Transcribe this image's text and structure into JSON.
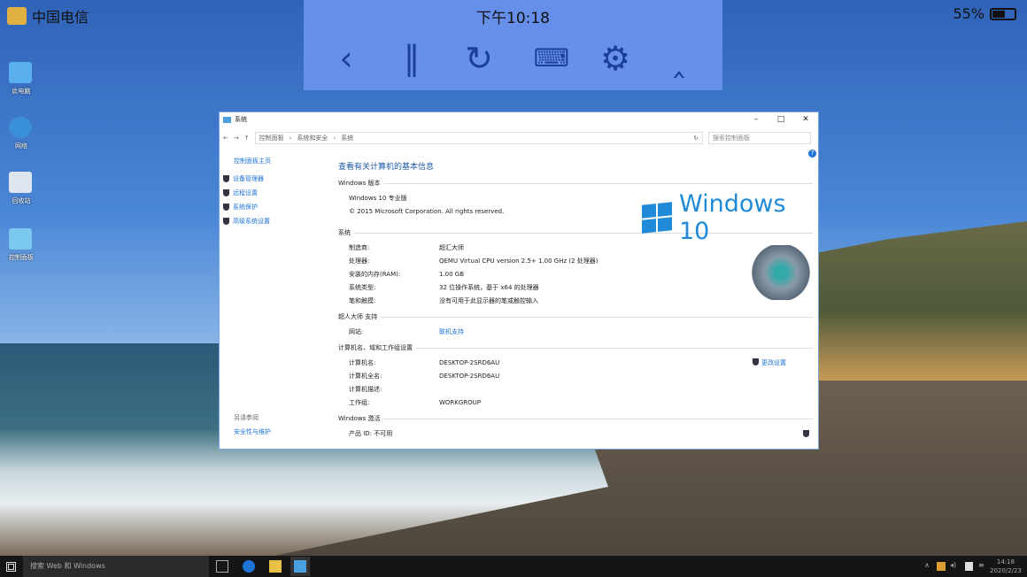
{
  "statusbar": {
    "carrier": "中国电信",
    "time": "下午10:18",
    "battery": "55%"
  },
  "remote_toolbar": {
    "icons": [
      "back-icon",
      "pause-icon",
      "rotate-icon",
      "keyboard-icon",
      "settings-icon",
      "collapse-icon"
    ]
  },
  "desktop": {
    "icons": [
      "此电脑",
      "网络",
      "回收站",
      "控制面板"
    ]
  },
  "window": {
    "title": "系统",
    "breadcrumb": [
      "控制面板",
      "系统和安全",
      "系统"
    ],
    "search_placeholder": "搜索控制面板",
    "sidebar": {
      "home": "控制面板主页",
      "links": [
        "设备管理器",
        "远程设置",
        "系统保护",
        "高级系统设置"
      ],
      "see_also": "另请参阅",
      "see_also_link": "安全性与维护"
    },
    "heading": "查看有关计算机的基本信息",
    "edition": {
      "title": "Windows 版本",
      "name": "Windows 10 专业版",
      "copyright": "© 2015 Microsoft Corporation. All rights reserved."
    },
    "logo_text": "Windows 10",
    "system": {
      "title": "系统",
      "rows": [
        {
          "k": "制造商:",
          "v": "超汇大师"
        },
        {
          "k": "处理器:",
          "v": "QEMU Virtual CPU version 2.5+   1.00 GHz  (2 处理器)"
        },
        {
          "k": "安装的内存(RAM):",
          "v": "1.00 GB"
        },
        {
          "k": "系统类型:",
          "v": "32 位操作系统，基于 x64 的处理器"
        },
        {
          "k": "笔和触摸:",
          "v": "没有可用于此显示器的笔或触控输入"
        }
      ]
    },
    "support": {
      "title": "超人大师 支持",
      "k": "网站:",
      "v": "联机支持"
    },
    "computer": {
      "title": "计算机名、域和工作组设置",
      "change": "更改设置",
      "rows": [
        {
          "k": "计算机名:",
          "v": "DESKTOP-2SRD6AU"
        },
        {
          "k": "计算机全名:",
          "v": "DESKTOP-2SRD6AU"
        },
        {
          "k": "计算机描述:",
          "v": ""
        },
        {
          "k": "工作组:",
          "v": "WORKGROUP"
        }
      ]
    },
    "activation": {
      "title": "Windows 激活",
      "product_id": "产品 ID: 不可用"
    }
  },
  "taskbar": {
    "search": "搜索 Web 和 Windows",
    "time": "14:18",
    "date": "2020/2/23"
  }
}
